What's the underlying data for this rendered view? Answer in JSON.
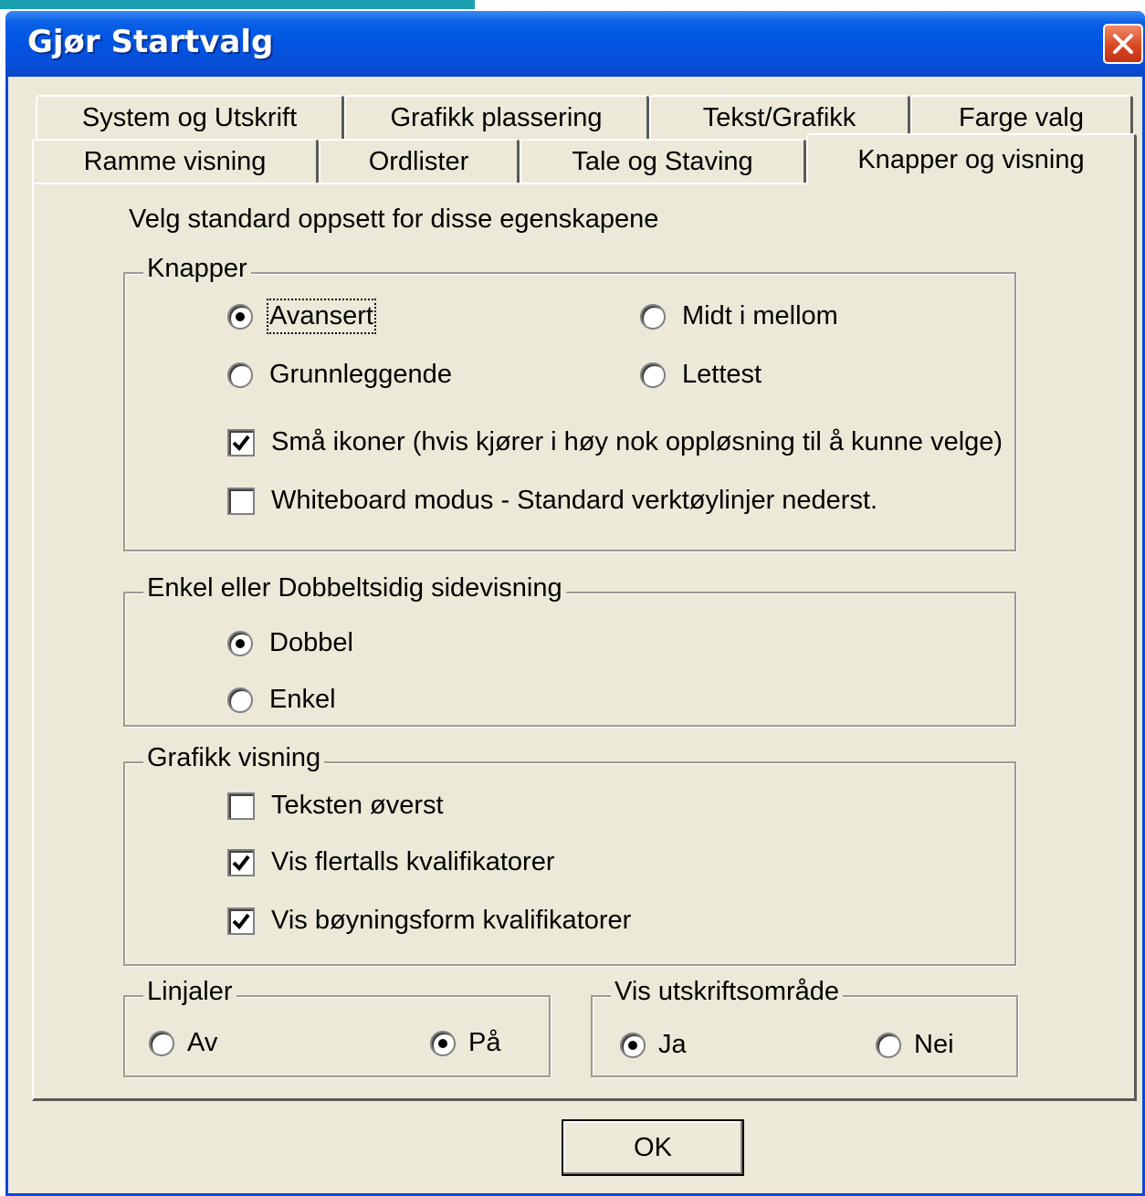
{
  "window": {
    "title": "Gjør Startvalg"
  },
  "tabs": {
    "row1": [
      "System og Utskrift",
      "Grafikk plassering",
      "Tekst/Grafikk",
      "Farge valg"
    ],
    "row2": [
      "Ramme visning",
      "Ordlister",
      "Tale og Staving",
      "Knapper og visning"
    ],
    "active": "Knapper og visning"
  },
  "panel": {
    "intro": "Velg standard oppsett for disse egenskapene",
    "knapper": {
      "legend": "Knapper",
      "options": [
        "Avansert",
        "Midt i mellom",
        "Grunnleggende",
        "Lettest"
      ],
      "selected": "Avansert",
      "small_icons": "Små ikoner (hvis kjører i høy nok oppløsning til å kunne velge)",
      "small_icons_checked": true,
      "whiteboard": "Whiteboard modus - Standard verktøylinjer nederst.",
      "whiteboard_checked": false
    },
    "sidevisning": {
      "legend": "Enkel eller Dobbeltsidig sidevisning",
      "options": [
        "Dobbel",
        "Enkel"
      ],
      "selected": "Dobbel"
    },
    "grafikk": {
      "legend": "Grafikk visning",
      "items": [
        "Teksten øverst",
        "Vis flertalls kvalifikatorer",
        "Vis bøyningsform kvalifikatorer"
      ],
      "checked": [
        false,
        true,
        true
      ]
    },
    "linjaler": {
      "legend": "Linjaler",
      "options": [
        "Av",
        "På"
      ],
      "selected": "På"
    },
    "utskrift": {
      "legend": "Vis utskriftsområde",
      "options": [
        "Ja",
        "Nei"
      ],
      "selected": "Ja"
    }
  },
  "buttons": {
    "ok": "OK"
  }
}
